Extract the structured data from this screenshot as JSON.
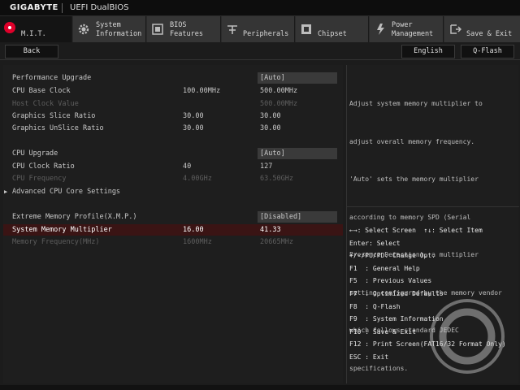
{
  "titlebar": {
    "brand": "GIGABYTE",
    "title": "UEFI DualBIOS"
  },
  "tabs": [
    {
      "id": "mit",
      "label1": "M.I.T.",
      "label2": "",
      "icon": "mit-icon"
    },
    {
      "id": "sysinfo",
      "label1": "System",
      "label2": "Information",
      "icon": "gear-icon"
    },
    {
      "id": "bios",
      "label1": "BIOS",
      "label2": "Features",
      "icon": "bios-icon"
    },
    {
      "id": "peripherals",
      "label1": "Peripherals",
      "label2": "",
      "icon": "peripherals-icon"
    },
    {
      "id": "chipset",
      "label1": "Chipset",
      "label2": "",
      "icon": "chipset-icon"
    },
    {
      "id": "power",
      "label1": "Power",
      "label2": "Management",
      "icon": "power-icon"
    },
    {
      "id": "save",
      "label1": "Save & Exit",
      "label2": "",
      "icon": "save-exit-icon"
    }
  ],
  "subbar": {
    "back": "Back",
    "language": "English",
    "qflash": "Q-Flash"
  },
  "settings": [
    {
      "name": "Performance Upgrade",
      "current": "",
      "value": "[Auto]"
    },
    {
      "name": "CPU Base Clock",
      "current": "100.00MHz",
      "value": "500.00MHz"
    },
    {
      "name": "Host Clock Value",
      "current": "",
      "value": "500.00MHz"
    },
    {
      "name": "Graphics Slice Ratio",
      "current": "30.00",
      "value": "30.00"
    },
    {
      "name": "Graphics UnSlice Ratio",
      "current": "30.00",
      "value": "30.00"
    },
    {
      "name": "CPU Upgrade",
      "current": "",
      "value": "[Auto]"
    },
    {
      "name": "CPU Clock Ratio",
      "current": "40",
      "value": "127"
    },
    {
      "name": "CPU Frequency",
      "current": "4.00GHz",
      "value": "63.50GHz"
    },
    {
      "name": "Advanced CPU Core Settings",
      "current": "",
      "value": ""
    },
    {
      "name": "Extreme Memory Profile(X.M.P.)",
      "current": "",
      "value": "[Disabled]"
    },
    {
      "name": "System Memory Multiplier",
      "current": "16.00",
      "value": "41.33"
    },
    {
      "name": "Memory Frequency(MHz)",
      "current": "1600MHz",
      "value": "20665MHz"
    }
  ],
  "help": {
    "lines": [
      "Adjust system memory multiplier to",
      "adjust overall memory frequency.",
      "'Auto' sets the memory multiplier",
      "according to memory SPD (Serial",
      "Presence Detection), a multiplier",
      "setting configured by the memory vendor",
      "which follows standard JEDEC",
      "specifications."
    ]
  },
  "keys": [
    "←→: Select Screen  ↑↓: Select Item",
    "Enter: Select",
    "+/-/PU/PD: Change Opt.",
    "F1  : General Help",
    "F5  : Previous Values",
    "F7  : Optimized Defaults",
    "F8  : Q-Flash",
    "F9  : System Information",
    "F10 : Save & Exit",
    "F12 : Print Screen(FAT16/32 Format Only)",
    "ESC : Exit"
  ],
  "colors": {
    "active_tab_icon": "#e0002a",
    "selected_row": "#3a1414",
    "dim_text": "#5e5e5e"
  }
}
